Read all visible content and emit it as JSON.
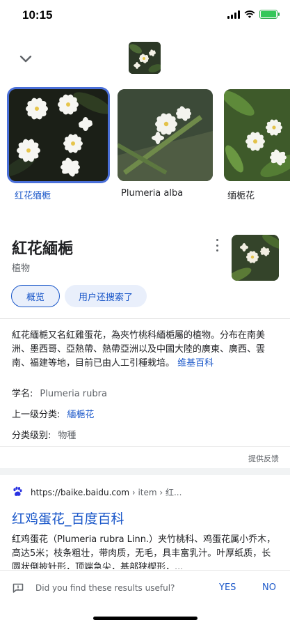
{
  "status_bar": {
    "time": "10:15"
  },
  "carousel": {
    "items": [
      {
        "label": "红花缅栀",
        "selected": true
      },
      {
        "label": "Plumeria alba",
        "selected": false
      },
      {
        "label": "缅栀花",
        "selected": false
      }
    ]
  },
  "entity": {
    "title": "紅花緬梔",
    "subtitle": "植物",
    "chips": {
      "overview": "概览",
      "related": "用户还搜索了"
    },
    "description": "紅花緬梔又名紅雞蛋花，為夾竹桃科緬梔屬的植物。分布在南美洲、墨西哥、亞熱帶、熱帶亞洲以及中國大陸的廣東、廣西、雲南、福建等地，目前已由人工引種栽培。",
    "source_link": "维基百科",
    "facts": [
      {
        "label": "学名:",
        "value": "Plumeria rubra",
        "is_link": false
      },
      {
        "label": "上一级分类:",
        "value": "緬梔花",
        "is_link": true
      },
      {
        "label": "分类级别:",
        "value": "物種",
        "is_link": false
      }
    ],
    "feedback_link": "提供反馈"
  },
  "result": {
    "url": "https://baike.baidu.com",
    "breadcrumb": " › item › 红...",
    "title": "红鸡蛋花_百度百科",
    "snippet": "红鸡蛋花（Plumeria rubra Linn.）夹竹桃科、鸡蛋花属小乔木，高达5米；枝条粗壮，带肉质，无毛，具丰富乳汁。叶厚纸质，长圆状倒披针形，顶端急尖，基部狭楔形，..."
  },
  "feedback_bar": {
    "question": "Did you find these results useful?",
    "yes": "YES",
    "no": "NO"
  },
  "colors": {
    "link": "#1a57c9",
    "selection_border": "#4a6fd8",
    "chip_bg": "#e9effb",
    "battery": "#34c759"
  }
}
